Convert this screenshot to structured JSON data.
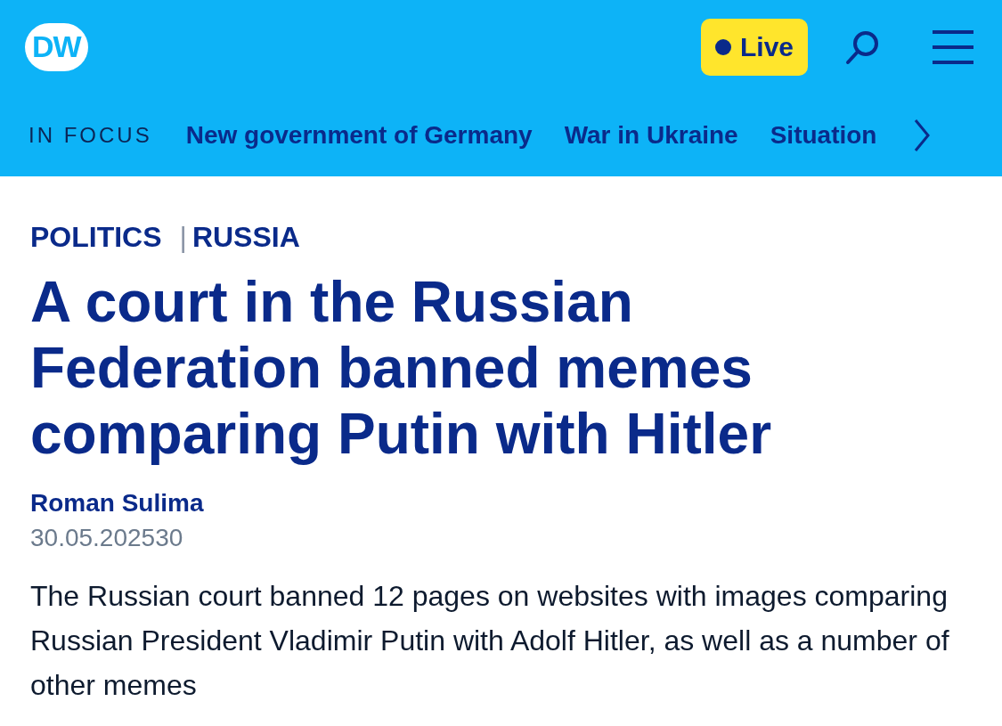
{
  "header": {
    "logo": "DW",
    "live_button": {
      "label": "Live"
    }
  },
  "focus_bar": {
    "label": "IN FOCUS",
    "links": [
      "New government of Germany",
      "War in Ukraine",
      "Situation"
    ]
  },
  "article": {
    "categories": [
      "POLITICS",
      "RUSSIA"
    ],
    "category_separator": "|",
    "headline": "A court in the Russian Federation banned memes comparing Putin with Hitler",
    "author": "Roman Sulima",
    "date": "30.05.202530",
    "lead": "The Russian court banned 12 pages on websites with images comparing Russian President Vladimir Putin with Adolf Hitler, as well as a number of other memes"
  }
}
